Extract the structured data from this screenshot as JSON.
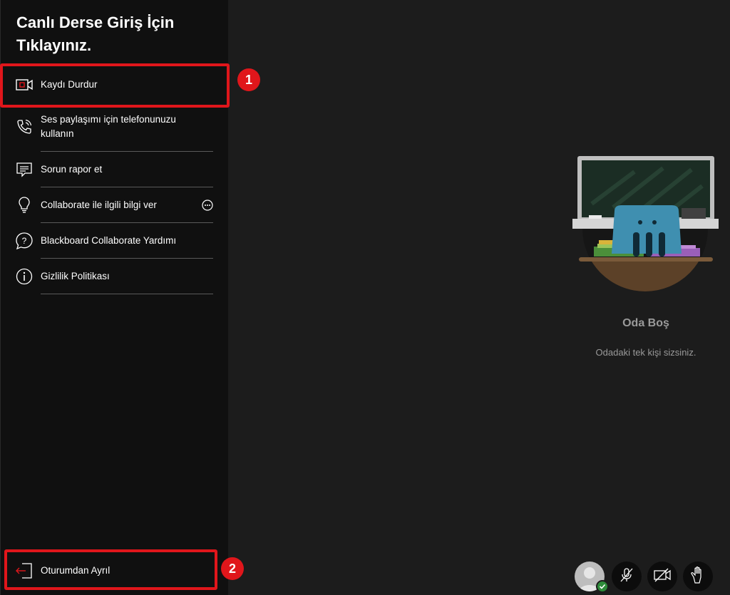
{
  "sidebar": {
    "title": "Canlı Derse Giriş İçin Tıklayınız.",
    "items": [
      {
        "label": "Kaydı Durdur",
        "icon": "record-icon"
      },
      {
        "label": "Ses paylaşımı için telefonunuzu kullanın",
        "icon": "phone-icon"
      },
      {
        "label": "Sorun rapor et",
        "icon": "report-icon"
      },
      {
        "label": "Collaborate ile ilgili bilgi ver",
        "icon": "lightbulb-icon"
      },
      {
        "label": "Blackboard Collaborate Yardımı",
        "icon": "help-icon"
      },
      {
        "label": "Gizlilik Politikası",
        "icon": "info-icon"
      }
    ],
    "leave": {
      "label": "Oturumdan Ayrıl",
      "icon": "exit-icon"
    }
  },
  "annotations": {
    "badge1": "1",
    "badge2": "2",
    "color": "#e0161b"
  },
  "main": {
    "empty_title": "Oda Boş",
    "empty_subtitle": "Odadaki tek kişi sizsiniz."
  },
  "controls": [
    "avatar",
    "microphone-muted-icon",
    "camera-off-icon",
    "raise-hand-icon"
  ]
}
